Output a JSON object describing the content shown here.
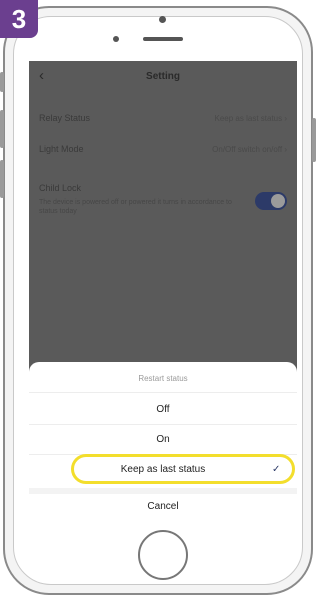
{
  "step": {
    "number": "3"
  },
  "screen": {
    "title": "Setting",
    "back_icon": "‹",
    "relay_status": {
      "label": "Relay Status",
      "value": "Keep as last status  ›"
    },
    "light_mode": {
      "label": "Light Mode",
      "value": "On/Off switch on/off  ›"
    },
    "child_lock": {
      "label": "Child Lock",
      "description": "The device is powered off or powered it turns in accordance to status today",
      "enabled": true
    }
  },
  "sheet": {
    "header": "Restart status",
    "options": [
      "Off",
      "On",
      "Keep as last status"
    ],
    "selected": "Keep as last status",
    "checkmark": "✓",
    "cancel": "Cancel"
  },
  "colors": {
    "badge": "#6b3f8f",
    "highlight": "#f3de2c",
    "toggle": "#2c3a68"
  }
}
